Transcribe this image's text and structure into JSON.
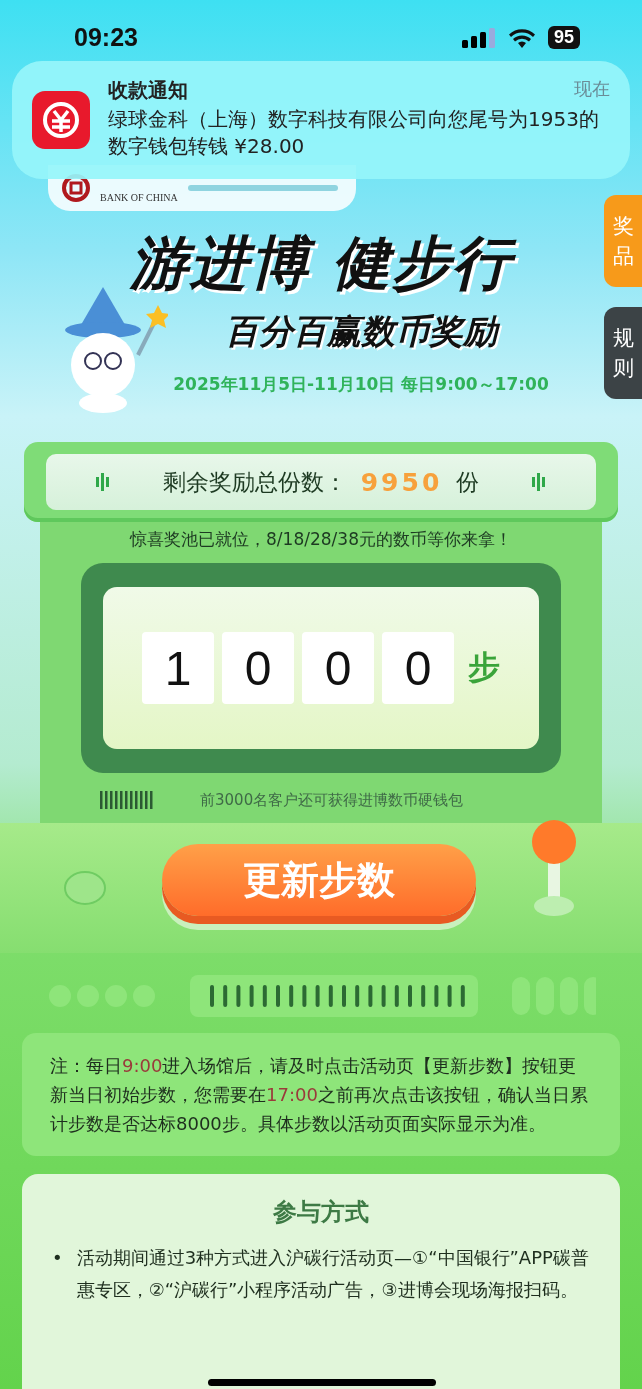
{
  "status_bar": {
    "time": "09:23",
    "battery": "95"
  },
  "notification": {
    "title": "收款通知",
    "time": "现在",
    "body": "绿球金科（上海）数字科技有限公司向您尾号为1953的数字钱包转钱 ¥28.00"
  },
  "logo_strip": {
    "bank_caption": "BANK OF CHINA"
  },
  "side_tabs": [
    {
      "label": "奖品",
      "kind": "prize"
    },
    {
      "label": "规则",
      "kind": "rules"
    }
  ],
  "hero": {
    "title": "游进博 健步行",
    "subtitle": "百分百赢数币奖励",
    "date": "2025年11月5日-11月10日 每日9:00～17:00"
  },
  "counter": {
    "label": "剩余奖励总份数：",
    "value": "9950",
    "unit": "份"
  },
  "slogan": "惊喜奖池已就位，8/18/28/38元的数币等你来拿！",
  "steps": {
    "digits": [
      "1",
      "0",
      "0",
      "0"
    ],
    "unit": "步"
  },
  "bonus_caption": "前3000名客户还可获得进博数币硬钱包",
  "update_button": "更新步数",
  "note": [
    {
      "text": "注：每日",
      "highlight": false
    },
    {
      "text": "9:00",
      "highlight": true
    },
    {
      "text": "进入场馆后，请及时点击活动页【更新步数】按钮更新当日初始步数，您需要在",
      "highlight": false
    },
    {
      "text": "17:00",
      "highlight": true
    },
    {
      "text": "之前再次点击该按钮，确认当日累计步数是否达标8000步。具体步数以活动页面实际显示为准。",
      "highlight": false
    }
  ],
  "participation": {
    "title": "参与方式",
    "items": [
      {
        "marker": "•",
        "text": "活动期间通过3种方式进入沪碳行活动页—①“中国银行”APP碳普惠专区，②“沪碳行”小程序活动广告，③进博会现场海报扫码。"
      }
    ]
  }
}
